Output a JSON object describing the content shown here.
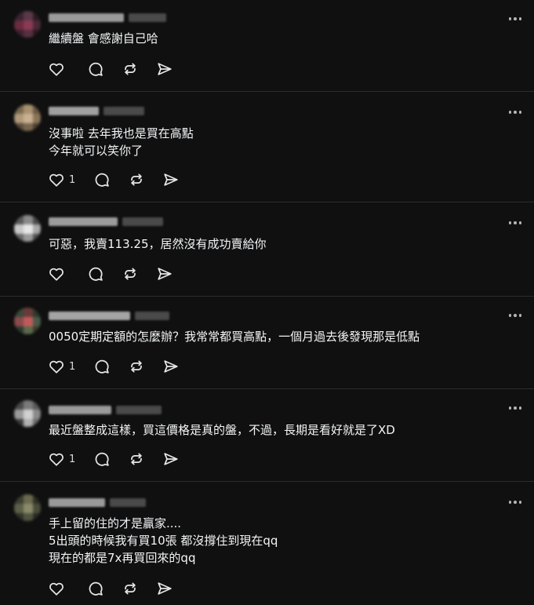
{
  "posts": [
    {
      "text": "繼續盤 會感謝自己哈",
      "like_count": ""
    },
    {
      "text": "沒事啦 去年我也是買在高點\n今年就可以笑你了",
      "like_count": "1"
    },
    {
      "text": "可惡，我賣113.25，居然沒有成功賣給你",
      "like_count": ""
    },
    {
      "text": "0050定期定額的怎麼辦？我常常都買高點，一個月過去後發現那是低點",
      "like_count": "1"
    },
    {
      "text": "最近盤整成這樣，買這價格是真的盤，不過，長期是看好就是了XD",
      "like_count": "1"
    },
    {
      "text": "手上留的住的才是贏家....\n5出頭的時候我有買10張 都沒撐住到現在qq\n現在的都是7x再買回來的qq",
      "like_count": ""
    }
  ],
  "icons": {
    "like": "heart-icon",
    "reply": "comment-icon",
    "repost": "repost-icon",
    "share": "send-icon",
    "more": "more-icon"
  },
  "colors": {
    "background": "#101010",
    "text": "#f3f5f7",
    "icon": "#e6e6e6",
    "divider": "#2d2d2d"
  }
}
